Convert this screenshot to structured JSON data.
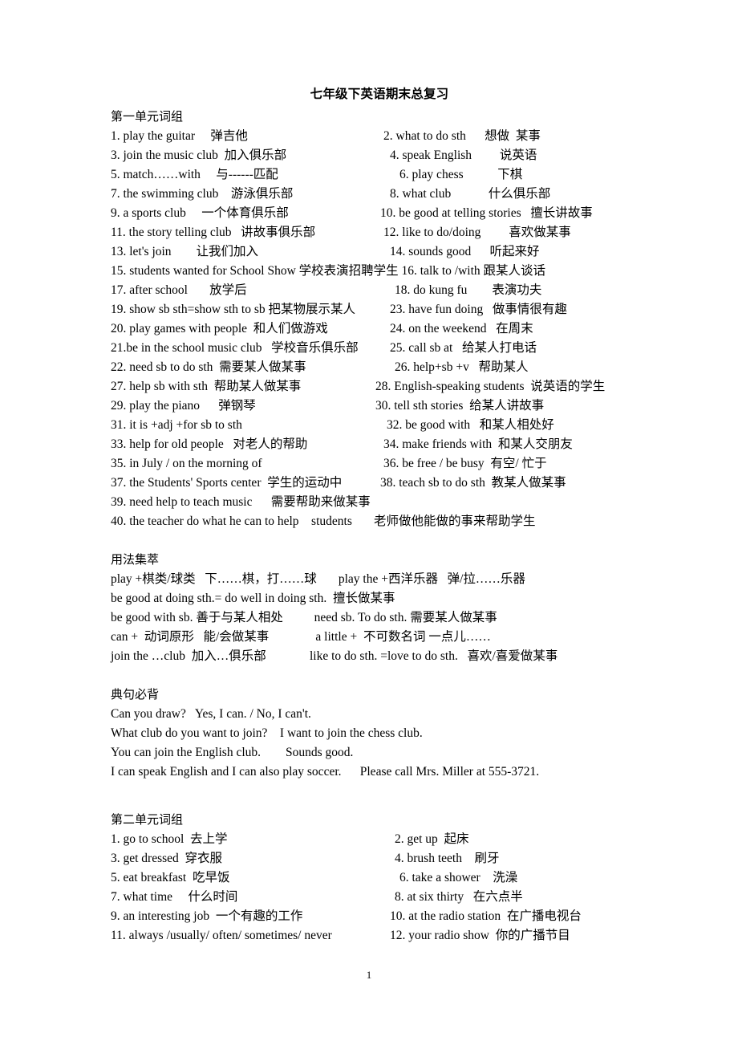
{
  "document": {
    "title": "七年级下英语期末总复习",
    "page_number": "1"
  },
  "unit1": {
    "heading": "第一单元词组",
    "phrases": [
      {
        "left": "1. play the guitar     弹吉他",
        "right": "2. what to do sth      想做  某事",
        "left_indent": "i0",
        "right_indent": "i10"
      },
      {
        "left": "3. join the music club  加入俱乐部",
        "right": "4. speak English         说英语",
        "left_indent": "i0",
        "right_indent": "i18"
      },
      {
        "left": "5. match……with     与------匹配",
        "right": "6. play chess           下棋",
        "left_indent": "i0",
        "right_indent": "i30"
      },
      {
        "left": "7. the swimming club    游泳俱乐部",
        "right": "8. what club            什么俱乐部",
        "left_indent": "i0",
        "right_indent": "i18"
      },
      {
        "left": "9. a sports club     一个体育俱乐部",
        "right": "10. be good at telling stories   擅长讲故事",
        "left_indent": "i0",
        "right_indent": "i6"
      },
      {
        "left": "11. the story telling club   讲故事俱乐部",
        "right": "12. like to do/doing         喜欢做某事",
        "left_indent": "i0",
        "right_indent": "i10"
      },
      {
        "left": "13. let's join        让我们加入",
        "right": "14. sounds good      听起来好",
        "left_indent": "i0",
        "right_indent": "i18"
      },
      {
        "left": "15. students wanted for School Show 学校表演招聘学生 16. talk to /with 跟某人谈话",
        "right": "",
        "left_indent": "i0",
        "right_indent": "i0",
        "wide": true
      },
      {
        "left": "17. after school       放学后",
        "right": "18. do kung fu        表演功夫",
        "left_indent": "i0",
        "right_indent": "i24"
      },
      {
        "left": "19. show sb sth=show sth to sb 把某物展示某人",
        "right": "23. have fun doing   做事情很有趣",
        "left_indent": "i0",
        "right_indent": "i18"
      },
      {
        "left": "20. play games with people  和人们做游戏",
        "right": "24. on the weekend   在周末",
        "left_indent": "i0",
        "right_indent": "i18"
      },
      {
        "left": "21.be in the school music club   学校音乐俱乐部",
        "right": "25. call sb at   给某人打电话",
        "left_indent": "i0",
        "right_indent": "i18"
      },
      {
        "left": "22. need sb to do sth  需要某人做某事",
        "right": "26. help+sb +v   帮助某人",
        "left_indent": "i0",
        "right_indent": "i24"
      },
      {
        "left": "27. help sb with sth  帮助某人做某事",
        "right": "28. English-speaking students  说英语的学生",
        "left_indent": "i0",
        "right_indent": "i0"
      },
      {
        "left": "29. play the piano      弹钢琴",
        "right": "30. tell sth stories  给某人讲故事",
        "left_indent": "i0",
        "right_indent": "i0"
      },
      {
        "left": "31. it is +adj +for sb to sth",
        "right": "32. be good with   和某人相处好",
        "left_indent": "i0",
        "right_indent": "i14"
      },
      {
        "left": "33. help for old people   对老人的帮助",
        "right": "34. make friends with  和某人交朋友",
        "left_indent": "i0",
        "right_indent": "i10"
      },
      {
        "left": "35. in July / on the morning of",
        "right": "36. be free / be busy  有空/ 忙于",
        "left_indent": "i0",
        "right_indent": "i10"
      },
      {
        "left": "37. the Students' Sports center  学生的运动中",
        "right": "38. teach sb to do sth  教某人做某事",
        "left_indent": "i0",
        "right_indent": "i6"
      },
      {
        "left": "39. need help to teach music      需要帮助来做某事",
        "right": "",
        "left_indent": "i0",
        "right_indent": "i0"
      },
      {
        "left": "40. the teacher do what he can to help    students       老师做他能做的事来帮助学生",
        "right": "",
        "left_indent": "i0",
        "right_indent": "i0",
        "wide": true
      }
    ]
  },
  "usage": {
    "heading": "用法集萃",
    "lines": [
      "play +棋类/球类   下……棋，打……球       play the +西洋乐器   弹/拉……乐器",
      "be good at doing sth.= do well in doing sth.  擅长做某事",
      "be good with sb. 善于与某人相处          need sb. To do sth. 需要某人做某事",
      "can +  动词原形   能/会做某事               a little +  不可数名词 一点儿……",
      "join the …club  加入…俱乐部              like to do sth. =love to do sth.   喜欢/喜爱做某事"
    ]
  },
  "sentences": {
    "heading": "典句必背",
    "lines": [
      "Can you draw?   Yes, I can. / No, I can't.",
      "What club do you want to join?    I want to join the chess club.",
      "You can join the English club.        Sounds good.",
      "I can speak English and I can also play soccer.      Please call Mrs. Miller at 555-3721."
    ]
  },
  "unit2": {
    "heading": "第二单元词组",
    "phrases": [
      {
        "left": "1. go to school  去上学",
        "right": "2. get up  起床",
        "left_indent": "i0",
        "right_indent": "i24"
      },
      {
        "left": "3. get dressed  穿衣服",
        "right": "4. brush teeth    刷牙",
        "left_indent": "i0",
        "right_indent": "i24"
      },
      {
        "left": "5. eat breakfast  吃早饭",
        "right": "6. take a shower    洗澡",
        "left_indent": "i0",
        "right_indent": "i30"
      },
      {
        "left": "7. what time     什么时间",
        "right": "8. at six thirty   在六点半",
        "left_indent": "i0",
        "right_indent": "i24"
      },
      {
        "left": "9. an interesting job  一个有趣的工作",
        "right": "10. at the radio station  在广播电视台",
        "left_indent": "i0",
        "right_indent": "i18"
      },
      {
        "left": "11. always /usually/ often/ sometimes/ never",
        "right": "12. your radio show  你的广播节目",
        "left_indent": "i0",
        "right_indent": "i18"
      }
    ]
  }
}
